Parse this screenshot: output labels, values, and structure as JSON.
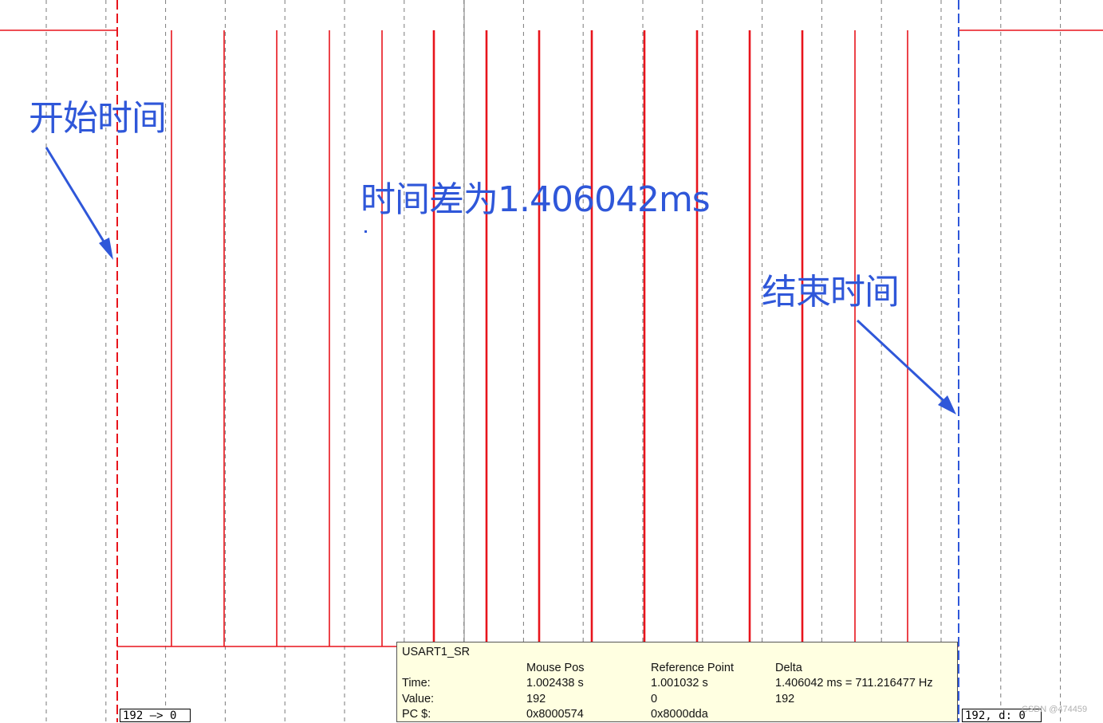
{
  "annotations": {
    "start": "开始时间",
    "delta": "时间差为1.406042ms",
    "end": "结束时间"
  },
  "signal_values": {
    "left": "192 —> 0",
    "right": "192,  d: 0"
  },
  "tooltip": {
    "signal": "USART1_SR",
    "columns": [
      "Mouse Pos",
      "Reference Point",
      "Delta"
    ],
    "rows": [
      {
        "label": "Time:",
        "mouse": "1.002438 s",
        "reference": "1.001032 s",
        "delta": "1.406042 ms = 711.216477 Hz"
      },
      {
        "label": "Value:",
        "mouse": "192",
        "reference": "0",
        "delta": "192"
      },
      {
        "label": "PC $:",
        "mouse": "0x8000574",
        "reference": "0x8000dda",
        "delta": ""
      }
    ]
  },
  "watermark": "CSDN @474459",
  "colors": {
    "signal": "#e8141c",
    "annotation": "#2f57d9",
    "reference_cursor": "#e8141c",
    "end_cursor": "#2f57d9",
    "tooltip_bg": "#ffffe1"
  }
}
